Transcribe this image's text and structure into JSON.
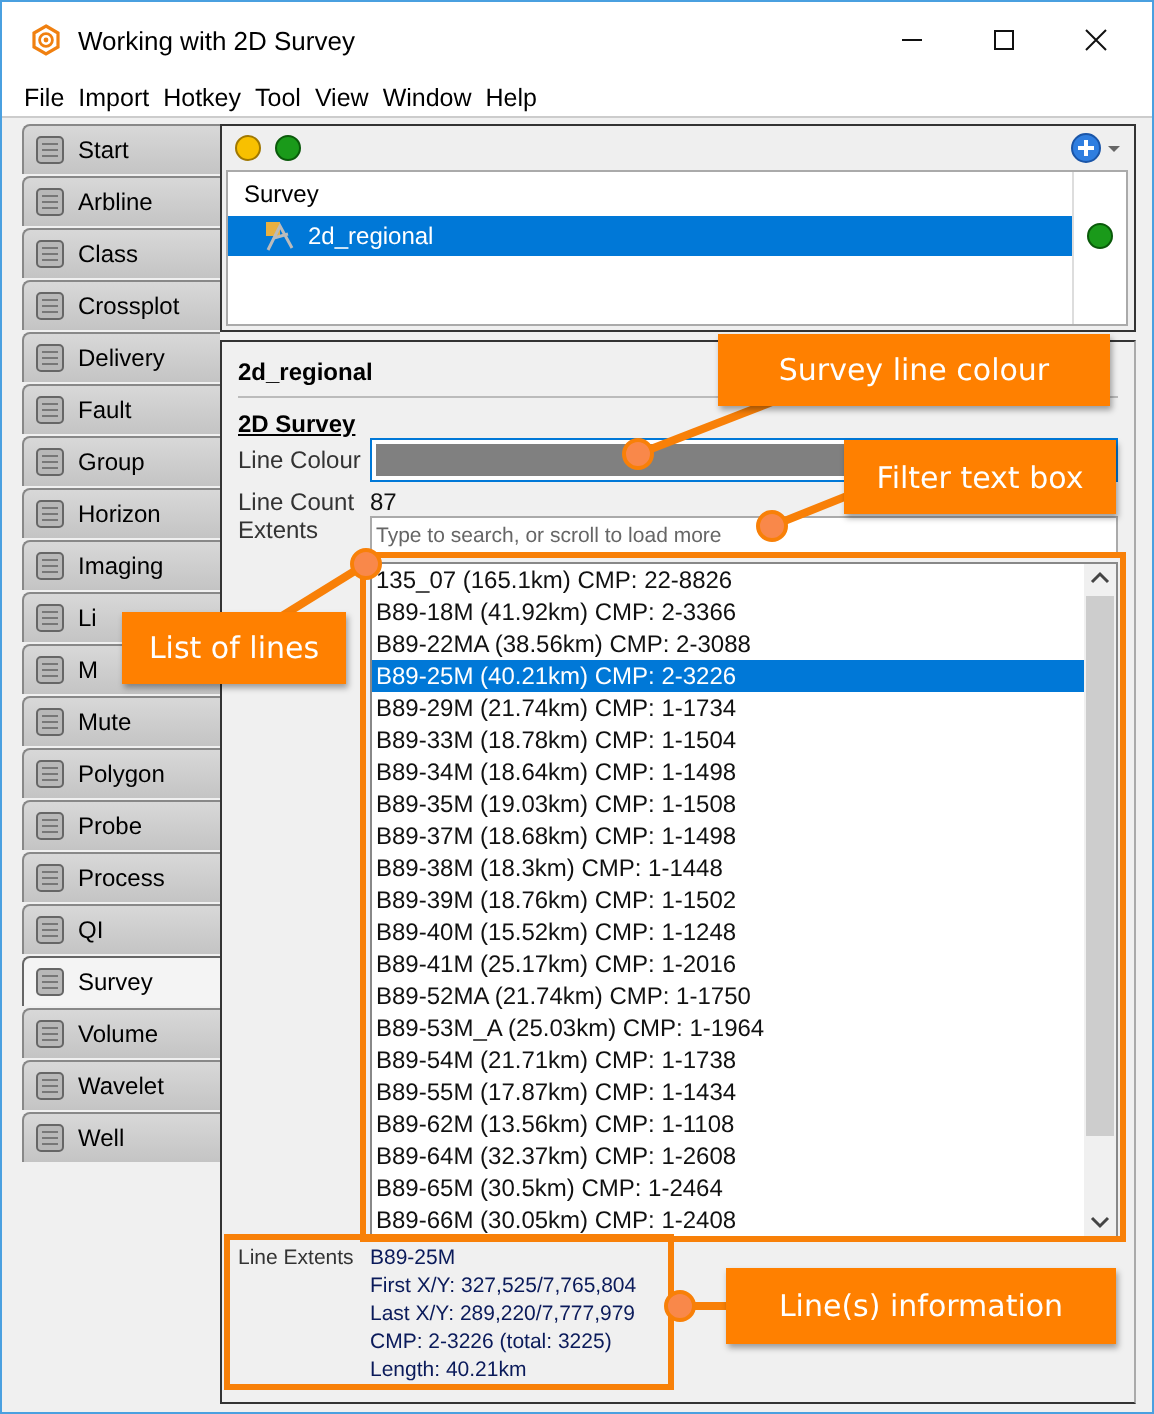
{
  "window": {
    "title": "Working with 2D Survey"
  },
  "menu": [
    "File",
    "Import",
    "Hotkey",
    "Tool",
    "View",
    "Window",
    "Help"
  ],
  "sidebar_tabs": [
    {
      "label": "Start",
      "selected": false
    },
    {
      "label": "Arbline",
      "selected": false
    },
    {
      "label": "Class",
      "selected": false
    },
    {
      "label": "Crossplot",
      "selected": false
    },
    {
      "label": "Delivery",
      "selected": false
    },
    {
      "label": "Fault",
      "selected": false
    },
    {
      "label": "Group",
      "selected": false
    },
    {
      "label": "Horizon",
      "selected": false
    },
    {
      "label": "Imaging",
      "selected": false
    },
    {
      "label": "Li",
      "selected": false
    },
    {
      "label": "M",
      "selected": false
    },
    {
      "label": "Mute",
      "selected": false
    },
    {
      "label": "Polygon",
      "selected": false
    },
    {
      "label": "Probe",
      "selected": false
    },
    {
      "label": "Process",
      "selected": false
    },
    {
      "label": "QI",
      "selected": false
    },
    {
      "label": "Survey",
      "selected": true
    },
    {
      "label": "Volume",
      "selected": false
    },
    {
      "label": "Wavelet",
      "selected": false
    },
    {
      "label": "Well",
      "selected": false
    }
  ],
  "tree": {
    "header": "Survey",
    "items": [
      {
        "label": "2d_regional",
        "selected": true
      }
    ]
  },
  "details": {
    "title": "2d_regional",
    "section": "2D Survey",
    "line_colour": {
      "label": "Line Colour",
      "color": "#808080"
    },
    "line_count": {
      "label": "Line Count",
      "value": "87"
    },
    "extents": {
      "label": "Extents",
      "placeholder": "Type to search, or scroll to load more"
    },
    "lines": [
      {
        "text": "135_07 (165.1km) CMP: 22-8826",
        "selected": false
      },
      {
        "text": "B89-18M (41.92km) CMP: 2-3366",
        "selected": false
      },
      {
        "text": "B89-22MA (38.56km) CMP: 2-3088",
        "selected": false
      },
      {
        "text": "B89-25M (40.21km) CMP: 2-3226",
        "selected": true
      },
      {
        "text": "B89-29M (21.74km) CMP: 1-1734",
        "selected": false
      },
      {
        "text": "B89-33M (18.78km) CMP: 1-1504",
        "selected": false
      },
      {
        "text": "B89-34M (18.64km) CMP: 1-1498",
        "selected": false
      },
      {
        "text": "B89-35M (19.03km) CMP: 1-1508",
        "selected": false
      },
      {
        "text": "B89-37M (18.68km) CMP: 1-1498",
        "selected": false
      },
      {
        "text": "B89-38M (18.3km) CMP: 1-1448",
        "selected": false
      },
      {
        "text": "B89-39M (18.76km) CMP: 1-1502",
        "selected": false
      },
      {
        "text": "B89-40M (15.52km) CMP: 1-1248",
        "selected": false
      },
      {
        "text": "B89-41M (25.17km) CMP: 1-2016",
        "selected": false
      },
      {
        "text": "B89-52MA (21.74km) CMP: 1-1750",
        "selected": false
      },
      {
        "text": "B89-53M_A (25.03km) CMP: 1-1964",
        "selected": false
      },
      {
        "text": "B89-54M (21.71km) CMP: 1-1738",
        "selected": false
      },
      {
        "text": "B89-55M (17.87km) CMP: 1-1434",
        "selected": false
      },
      {
        "text": "B89-62M (13.56km) CMP: 1-1108",
        "selected": false
      },
      {
        "text": "B89-64M (32.37km) CMP: 1-2608",
        "selected": false
      },
      {
        "text": "B89-65M (30.5km) CMP: 1-2464",
        "selected": false
      },
      {
        "text": "B89-66M (30.05km) CMP: 1-2408",
        "selected": false
      }
    ],
    "line_extents": {
      "label": "Line Extents",
      "values": [
        "B89-25M",
        "First X/Y: 327,525/7,765,804",
        "Last X/Y: 289,220/7,777,979",
        "CMP: 2-3226 (total: 3225)",
        "Length: 40.21km"
      ]
    }
  },
  "callouts": [
    "Survey line colour",
    "Filter text box",
    "List of lines",
    "Line(s) information"
  ]
}
